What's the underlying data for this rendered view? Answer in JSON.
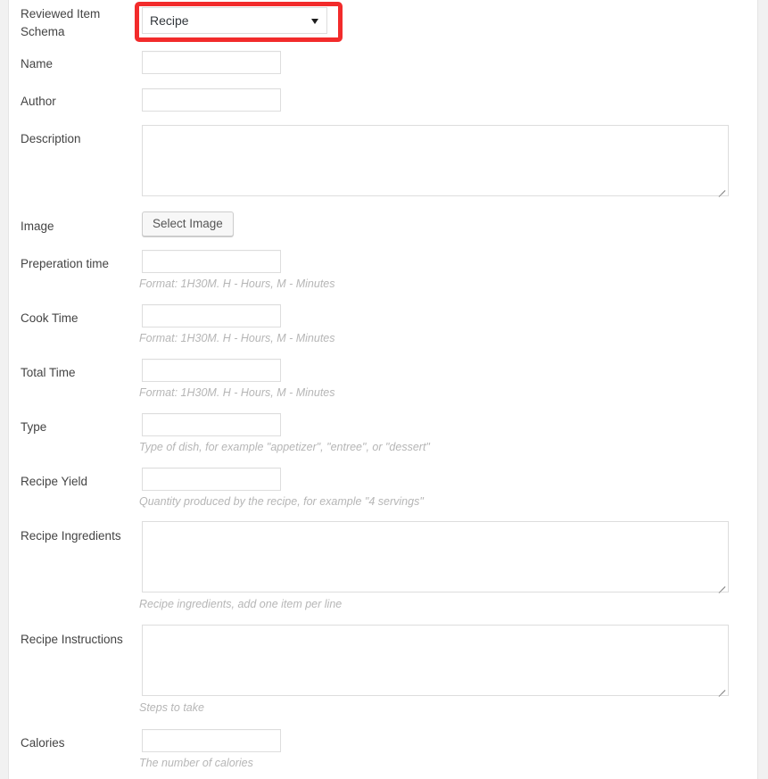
{
  "theme": {
    "page_background": "#f1f1f1",
    "panel_background": "#ffffff",
    "panel_border": "#e5e5e5",
    "label_color": "#444444",
    "help_color": "#b6b6b6",
    "input_border": "#dddddd",
    "annotation_color": "#f22b2b",
    "button_background": "#f7f7f7",
    "button_border": "#cccccc"
  },
  "form": {
    "rows": [
      {
        "id": "reviewed-item-schema",
        "label": "Reviewed Item Schema",
        "control": "select",
        "value": "Recipe",
        "highlighted": true,
        "help": ""
      },
      {
        "id": "name",
        "label": "Name",
        "control": "text",
        "value": "",
        "placeholder": "",
        "help": ""
      },
      {
        "id": "author",
        "label": "Author",
        "control": "text",
        "value": "",
        "placeholder": "",
        "help": ""
      },
      {
        "id": "description",
        "label": "Description",
        "control": "textarea",
        "value": "",
        "placeholder": "",
        "help": ""
      },
      {
        "id": "image",
        "label": "Image",
        "control": "button",
        "value": "Select Image",
        "help": ""
      },
      {
        "id": "preperation-time",
        "label": "Preperation time",
        "control": "text",
        "value": "",
        "placeholder": "",
        "help": "Format: 1H30M. H - Hours, M - Minutes"
      },
      {
        "id": "cook-time",
        "label": "Cook Time",
        "control": "text",
        "value": "",
        "placeholder": "",
        "help": "Format: 1H30M. H - Hours, M - Minutes"
      },
      {
        "id": "total-time",
        "label": "Total Time",
        "control": "text",
        "value": "",
        "placeholder": "",
        "help": "Format: 1H30M. H - Hours, M - Minutes"
      },
      {
        "id": "type",
        "label": "Type",
        "control": "text",
        "value": "",
        "placeholder": "",
        "help": "Type of dish, for example \"appetizer\", \"entree\", or \"dessert\""
      },
      {
        "id": "recipe-yield",
        "label": "Recipe Yield",
        "control": "text",
        "value": "",
        "placeholder": "",
        "help": "Quantity produced by the recipe, for example \"4 servings\""
      },
      {
        "id": "recipe-ingredients",
        "label": "Recipe Ingredients",
        "control": "textarea",
        "value": "",
        "placeholder": "",
        "help": "Recipe ingredients, add one item per line"
      },
      {
        "id": "recipe-instructions",
        "label": "Recipe Instructions",
        "control": "textarea",
        "value": "",
        "placeholder": "",
        "help": "Steps to take"
      },
      {
        "id": "calories",
        "label": "Calories",
        "control": "text",
        "value": "",
        "placeholder": "",
        "help": "The number of calories"
      }
    ]
  },
  "icons": {
    "select_chevron": "chevron-down-icon",
    "resize_grip": "resize-grip-icon"
  }
}
